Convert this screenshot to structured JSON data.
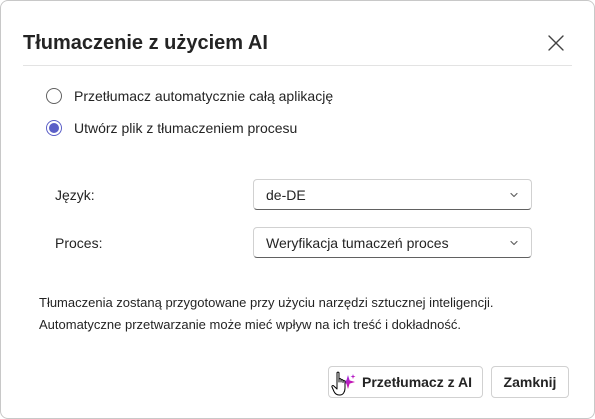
{
  "dialog": {
    "title": "Tłumaczenie z użyciem AI",
    "close_icon": "close-icon"
  },
  "options": [
    {
      "label": "Przetłumacz automatycznie całą aplikację",
      "checked": false
    },
    {
      "label": "Utwórz plik z tłumaczeniem procesu",
      "checked": true
    }
  ],
  "fields": {
    "language": {
      "label": "Język:",
      "value": "de-DE"
    },
    "process": {
      "label": "Proces:",
      "value": "Weryfikacja tumaczeń proces"
    }
  },
  "info": {
    "line1": "Tłumaczenia zostaną przygotowane przy użyciu narzędzi sztucznej inteligencji.",
    "line2": "Automatyczne przetwarzanie może mieć wpływ na ich treść i dokładność."
  },
  "buttons": {
    "translate": "Przetłumacz z AI",
    "close": "Zamknij"
  },
  "colors": {
    "accent": "#5b5fc7",
    "sparkle_start": "#8a3ffc",
    "sparkle_end": "#e3008c"
  }
}
